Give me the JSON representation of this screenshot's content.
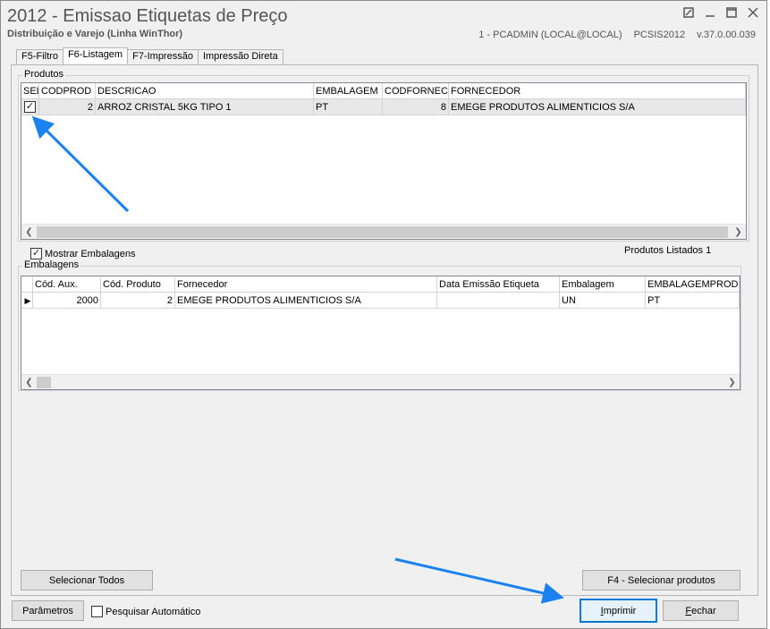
{
  "window": {
    "title": "2012 - Emissao Etiquetas de Preço",
    "subtitle": "Distribuição e Varejo (Linha WinThor)",
    "user": "1 - PCADMIN (LOCAL@LOCAL)",
    "module": "PCSIS2012",
    "version": "v.37.0.00.039",
    "controls": {
      "restore_icon": "restore-icon",
      "minimize_icon": "minimize-icon",
      "maximize_icon": "maximize-icon",
      "close_icon": "close-icon"
    }
  },
  "tabs": [
    {
      "label": "F5-Filtro",
      "active": false
    },
    {
      "label": "F6-Listagem",
      "active": true
    },
    {
      "label": "F7-Impressão",
      "active": false
    },
    {
      "label": "Impressão Direta",
      "active": false
    }
  ],
  "produtos": {
    "group_label": "Produtos",
    "columns": [
      "SEL",
      "CODPROD",
      "DESCRICAO",
      "EMBALAGEM",
      "CODFORNEC",
      "FORNECEDOR"
    ],
    "rows": [
      {
        "sel": true,
        "codprod": "2",
        "descricao": "ARROZ CRISTAL 5KG TIPO 1",
        "embalagem": "PT",
        "codfornec": "8",
        "fornecedor": "EMEGE PRODUTOS ALIMENTICIOS S/A"
      }
    ]
  },
  "mostrar_embalagens": {
    "label": "Mostrar Embalagens",
    "checked": true
  },
  "produtos_listados": "Produtos Listados 1",
  "embalagens": {
    "group_label": "Embalagens",
    "columns": [
      "Cód. Aux.",
      "Cód. Produto",
      "Fornecedor",
      "Data Emissão Etiqueta",
      "Embalagem",
      "EMBALAGEMPRODUT"
    ],
    "rows": [
      {
        "cod_aux": "2000",
        "cod_produto": "2",
        "fornecedor": "EMEGE PRODUTOS ALIMENTICIOS S/A",
        "data_emissao": "",
        "embalagem": "UN",
        "embalagem_produto": "PT"
      }
    ]
  },
  "buttons": {
    "selecionar_todos": "Selecionar Todos",
    "selecionar_produtos": "F4 - Selecionar produtos",
    "parametros": "Parâmetros",
    "imprimir": "Imprimir",
    "fechar": "Fechar"
  },
  "pesquisar_automatico": {
    "label": "Pesquisar Automático",
    "checked": false
  },
  "colors": {
    "accent": "#0078d7",
    "annotation_arrow": "#1a82f0"
  }
}
